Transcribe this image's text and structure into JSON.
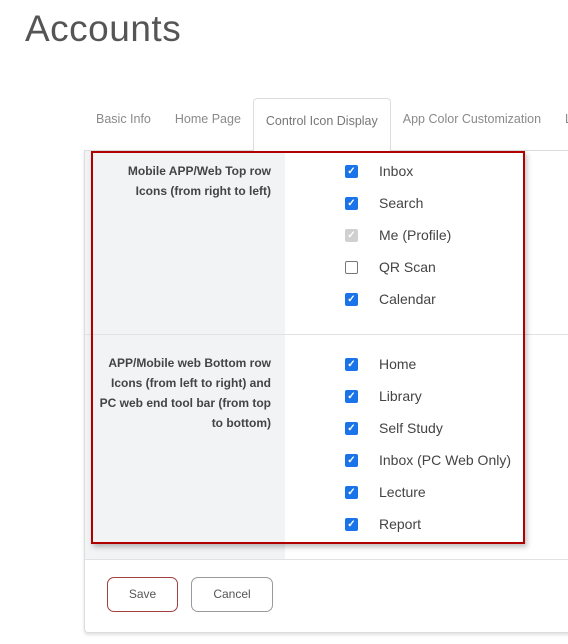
{
  "page_title": "Accounts",
  "tabs": [
    {
      "label": "Basic Info"
    },
    {
      "label": "Home Page"
    },
    {
      "label": "Control Icon Display",
      "active": true
    },
    {
      "label": "App Color Customization"
    },
    {
      "label": "Libr"
    }
  ],
  "sections": [
    {
      "label": "Mobile APP/Web Top row Icons (from right to left)",
      "options": [
        {
          "label": "Inbox",
          "state": "checked"
        },
        {
          "label": "Search",
          "state": "checked"
        },
        {
          "label": "Me (Profile)",
          "state": "checked-disabled"
        },
        {
          "label": "QR Scan",
          "state": "unchecked"
        },
        {
          "label": "Calendar",
          "state": "checked"
        }
      ]
    },
    {
      "label": "APP/Mobile web Bottom row Icons (from left to right) and PC web end tool bar (from top to bottom)",
      "options": [
        {
          "label": "Home",
          "state": "checked"
        },
        {
          "label": "Library",
          "state": "checked"
        },
        {
          "label": "Self Study",
          "state": "checked"
        },
        {
          "label": "Inbox (PC Web Only)",
          "state": "checked"
        },
        {
          "label": "Lecture",
          "state": "checked"
        },
        {
          "label": "Report",
          "state": "checked"
        }
      ]
    }
  ],
  "buttons": {
    "save": "Save",
    "cancel": "Cancel"
  },
  "colors": {
    "checkbox": "#1a73e8",
    "highlight": "#b00000",
    "label_column": "#f1f3f5"
  }
}
